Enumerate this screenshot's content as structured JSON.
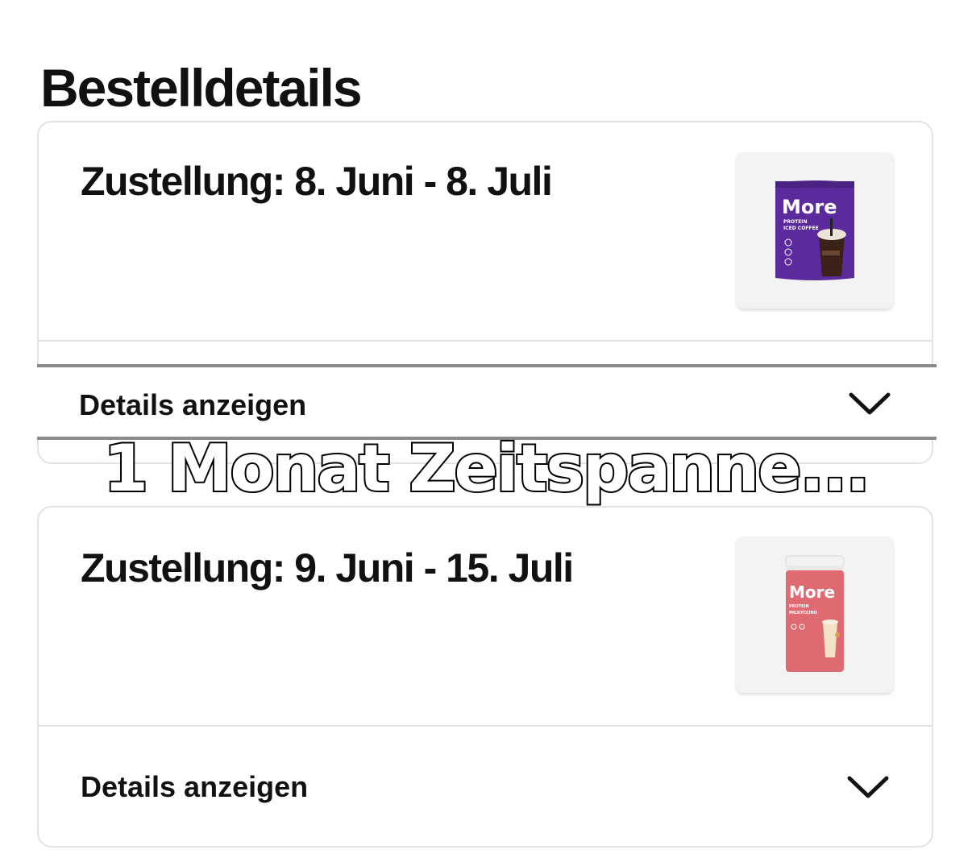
{
  "page": {
    "title": "Bestelldetails"
  },
  "orders": [
    {
      "delivery": "Zustellung: 8. Juni - 8. Juli",
      "details_label": "Details anzeigen",
      "product": {
        "brand": "More",
        "line1": "PROTEIN",
        "line2": "ICED COFFEE",
        "color": "#5b2a9c"
      }
    },
    {
      "delivery": "Zustellung: 9. Juni - 15. Juli",
      "details_label": "Details anzeigen",
      "product": {
        "brand": "More",
        "line1": "PROTEIN",
        "line2": "MILKYCCINO",
        "color": "#e06a72"
      }
    }
  ],
  "overlay": {
    "caption": "1 Monat Zeitspanne..."
  },
  "icons": {
    "expand": "chevron-down-icon"
  }
}
